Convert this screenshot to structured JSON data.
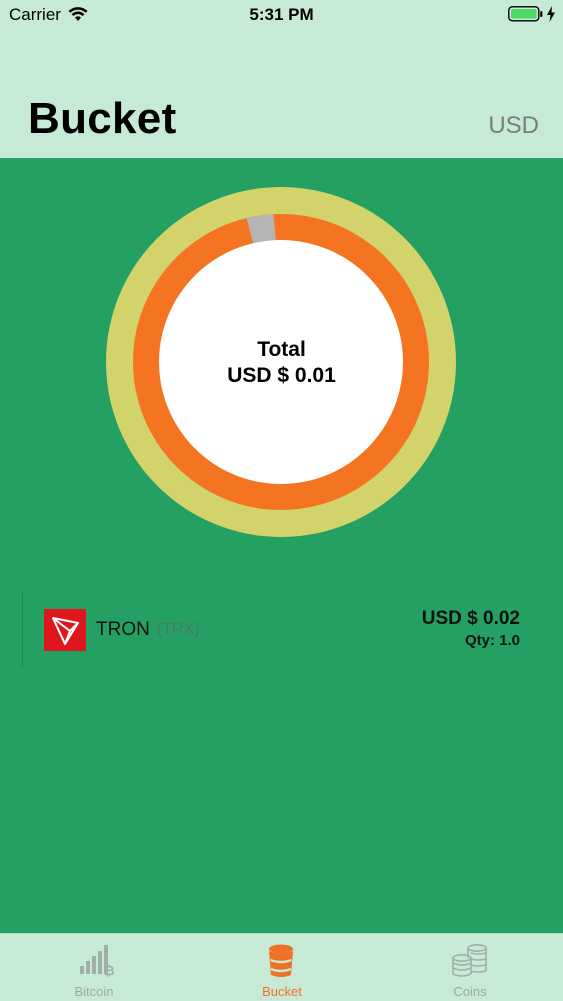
{
  "status_bar": {
    "carrier": "Carrier",
    "time": "5:31 PM"
  },
  "header": {
    "title": "Bucket",
    "currency": "USD"
  },
  "summary": {
    "total_label": "Total",
    "total_value": "USD $ 0.01"
  },
  "donut": {
    "outer_color": "#d3d36c",
    "inner_color": "#f47421",
    "gap_color": "#b5b5b5",
    "center_color": "#ffffff"
  },
  "coins": [
    {
      "name": "TRON",
      "symbol": "(TRX)",
      "value": "USD $ 0.02",
      "qty": "Qty: 1.0"
    }
  ],
  "tabs": [
    {
      "label": "Bitcoin",
      "icon": "bitcoin-chart-icon",
      "active": false
    },
    {
      "label": "Bucket",
      "icon": "bucket-icon",
      "active": true
    },
    {
      "label": "Coins",
      "icon": "coins-stack-icon",
      "active": false
    }
  ],
  "colors": {
    "header_bg": "#c7ead6",
    "main_bg": "#24a063",
    "accent": "#f07025",
    "tron_red": "#e0161f"
  }
}
